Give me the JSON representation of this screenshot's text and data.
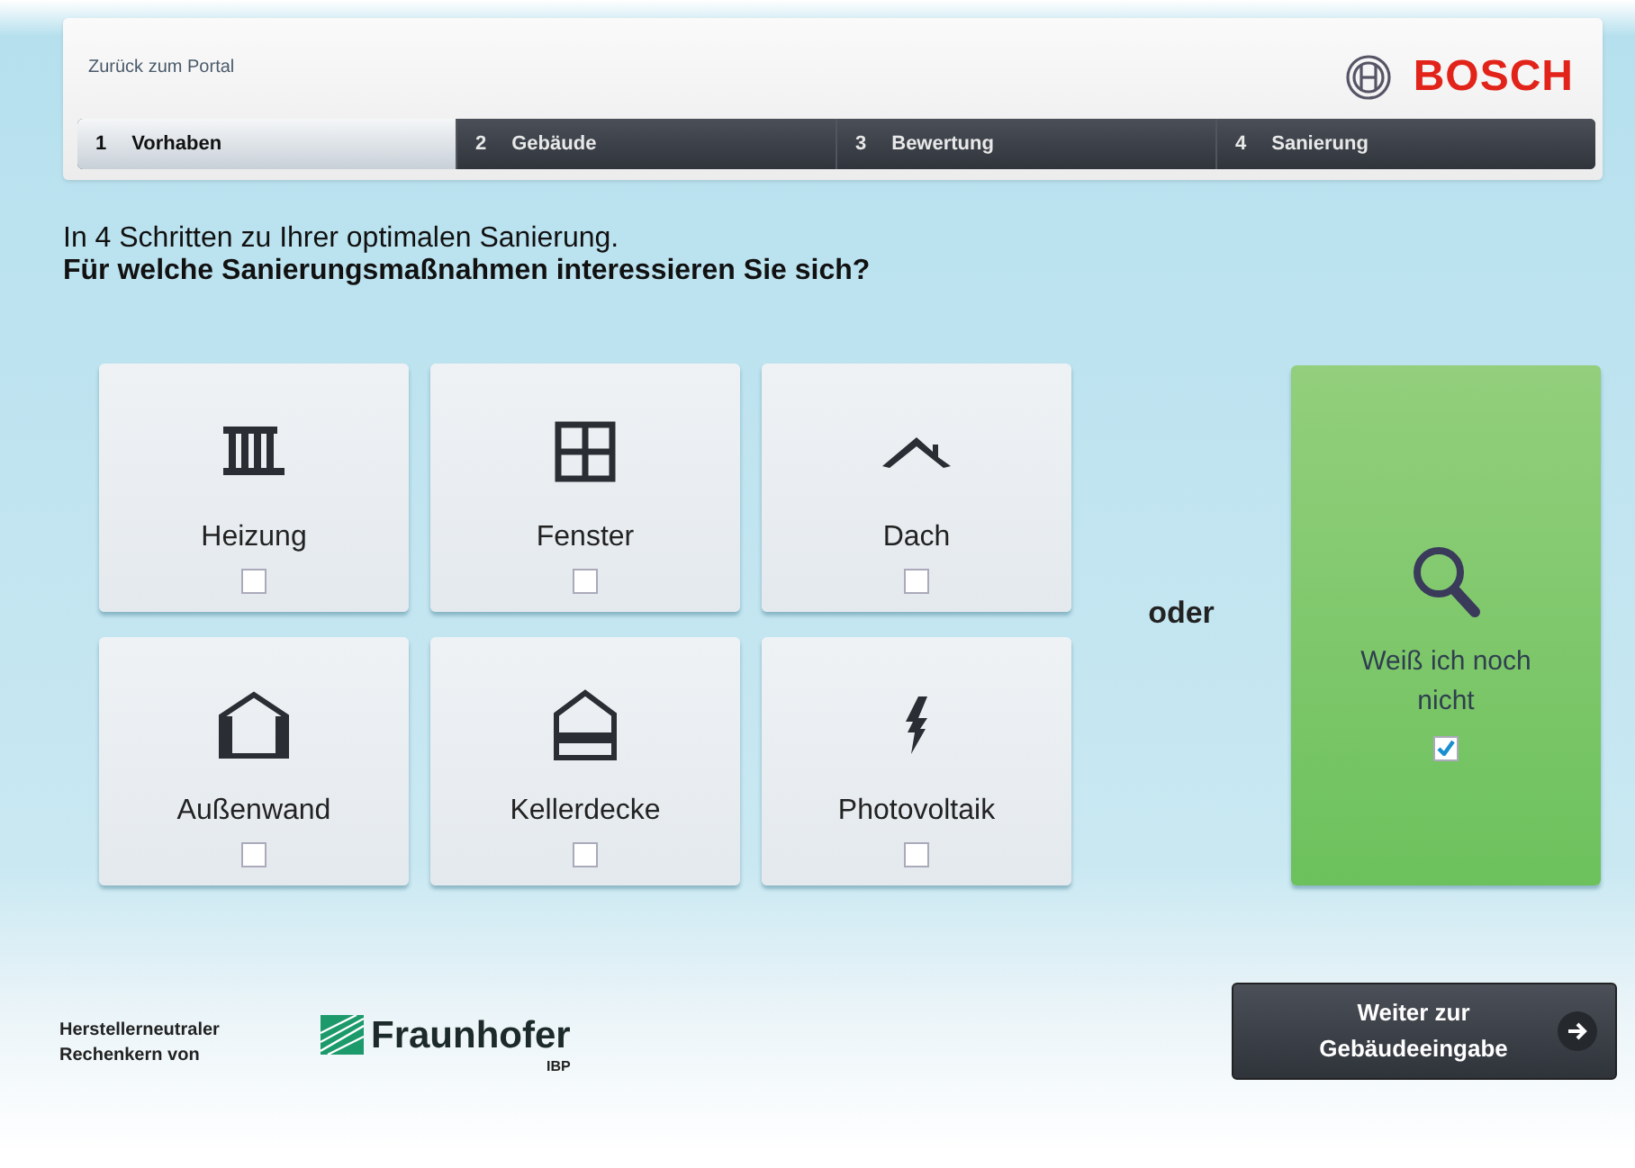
{
  "header": {
    "back_link": "Zurück zum Portal",
    "brand": "BOSCH"
  },
  "steps": [
    {
      "number": "1",
      "label": "Vorhaben",
      "selected": true
    },
    {
      "number": "2",
      "label": "Gebäude",
      "selected": false
    },
    {
      "number": "3",
      "label": "Bewertung",
      "selected": false
    },
    {
      "number": "4",
      "label": "Sanierung",
      "selected": false
    }
  ],
  "intro": "In 4 Schritten zu Ihrer optimalen Sanierung.",
  "question": "Für welche Sanierungsmaßnahmen interessieren Sie sich?",
  "options": [
    {
      "kind": "heating",
      "label": "Heizung",
      "checked": false
    },
    {
      "kind": "window",
      "label": "Fenster",
      "checked": false
    },
    {
      "kind": "roof",
      "label": "Dach",
      "checked": false
    },
    {
      "kind": "wall",
      "label": "Außenwand",
      "checked": false
    },
    {
      "kind": "basement",
      "label": "Kellerdecke",
      "checked": false
    },
    {
      "kind": "solar",
      "label": "Photovoltaik",
      "checked": false
    }
  ],
  "separator": "oder",
  "unsure": {
    "label": "Weiß ich noch nicht",
    "checked": true
  },
  "footer": {
    "credit": "Herstellerneutraler Rechenkern von",
    "partner": "Fraunhofer",
    "partner_sub": "IBP",
    "next_button": "Weiter zur Gebäudeeingabe"
  }
}
